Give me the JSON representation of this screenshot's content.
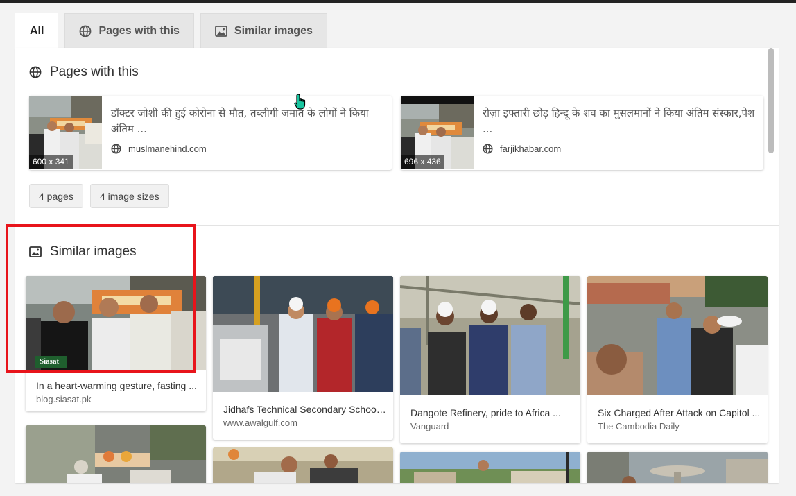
{
  "tabs": [
    {
      "label": "All",
      "active": true
    },
    {
      "label": "Pages with this",
      "icon": "globe-icon"
    },
    {
      "label": "Similar images",
      "icon": "image-icon"
    }
  ],
  "pages_section": {
    "title": "Pages with this",
    "cards": [
      {
        "text": "डॉक्टर जोशी की हुई कोरोना से मौत, तब्लीगी जमात के लोगों ने किया अंतिम ...",
        "dims": "600 x 341",
        "site": "muslmanehind.com"
      },
      {
        "text": "रोज़ा इफ्तारी छोड़ हिन्दू के शव का मुसलमानों ने किया अंतिम संस्कार,पेश ...",
        "dims": "696 x 436",
        "site": "farjikhabar.com"
      }
    ],
    "chips": [
      "4 pages",
      "4 image sizes"
    ]
  },
  "similar_section": {
    "title": "Similar images",
    "items": [
      {
        "caption": "In a heart-warming gesture, fasting ...",
        "source": "blog.siasat.pk",
        "watermark": "Siasat"
      },
      {
        "caption": "Jidhafs Technical Secondary School ...",
        "source": "www.awalgulf.com"
      },
      {
        "caption": "Dangote Refinery, pride to Africa ...",
        "source": "Vanguard"
      },
      {
        "caption": "Six Charged After Attack on Capitol ...",
        "source": "The Cambodia Daily"
      }
    ]
  },
  "colors": {
    "highlight": "#e8141b",
    "cursor": "#19c6a0"
  }
}
